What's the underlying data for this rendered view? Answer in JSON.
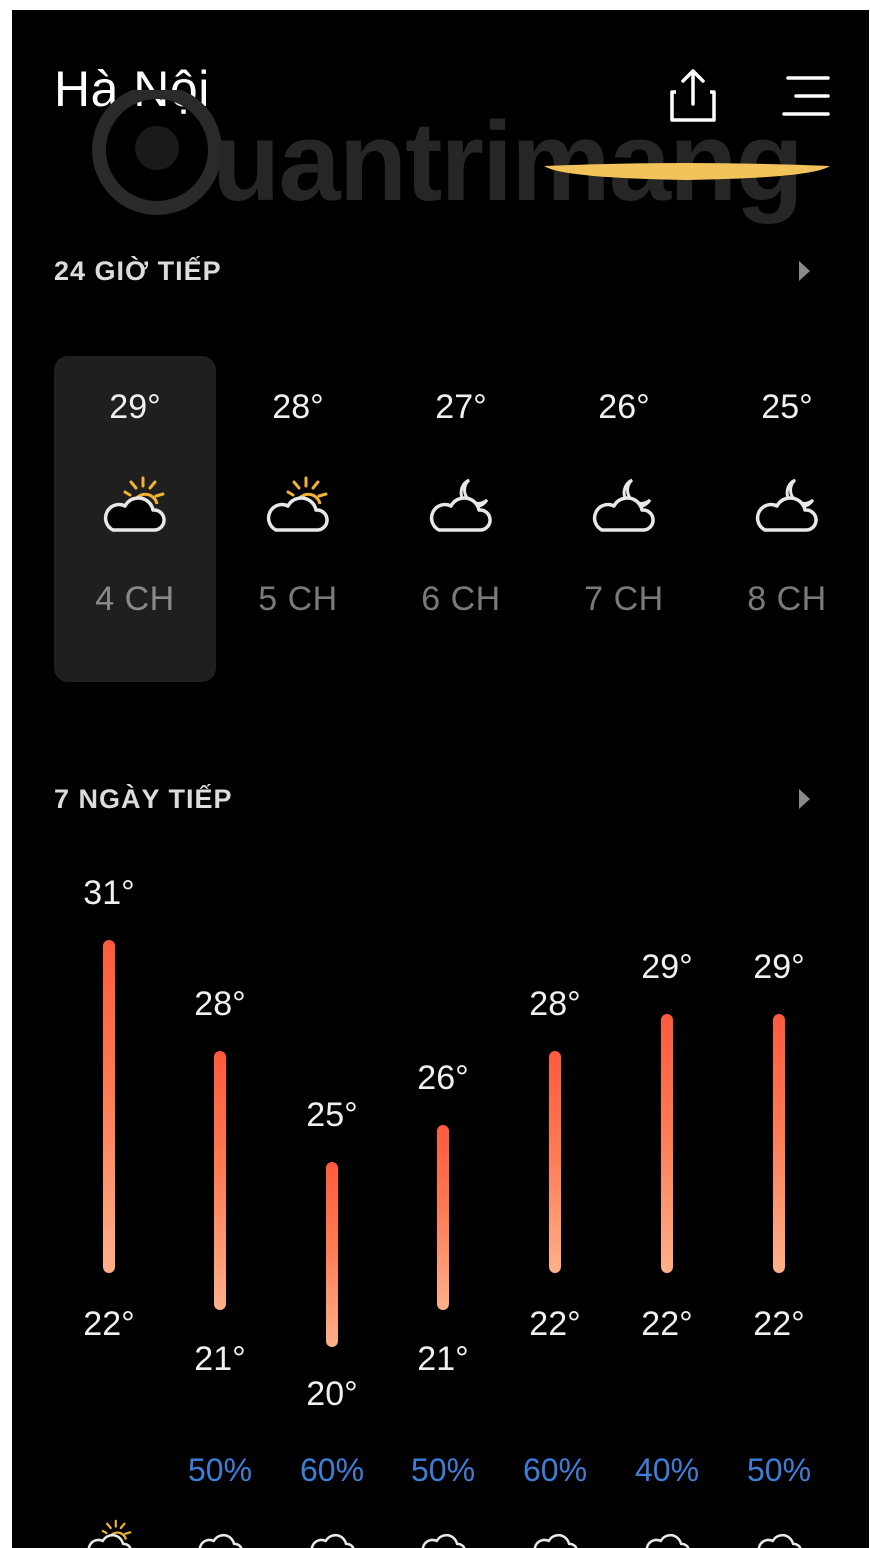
{
  "header": {
    "city": "Hà Nội",
    "watermark_text": "Quantrimang",
    "share_icon": "share-icon",
    "menu_icon": "menu-icon"
  },
  "hourly": {
    "section_title": "24 GIỜ TIẾP",
    "arrow_icon": "chevron-right-icon",
    "items": [
      {
        "temp": "29°",
        "label": "4 CH",
        "icon": "partly-sunny-icon",
        "selected": true
      },
      {
        "temp": "28°",
        "label": "5 CH",
        "icon": "partly-sunny-icon",
        "selected": false
      },
      {
        "temp": "27°",
        "label": "6 CH",
        "icon": "partly-cloudy-night-icon",
        "selected": false
      },
      {
        "temp": "26°",
        "label": "7 CH",
        "icon": "partly-cloudy-night-icon",
        "selected": false
      },
      {
        "temp": "25°",
        "label": "8 CH",
        "icon": "partly-cloudy-night-icon",
        "selected": false
      }
    ]
  },
  "daily": {
    "section_title": "7 NGÀY TIẾP",
    "arrow_icon": "chevron-right-icon",
    "items": [
      {
        "high": "31°",
        "low": "22°",
        "high_value": 31,
        "low_value": 22,
        "rain": "",
        "icon": "partly-sunny-icon"
      },
      {
        "high": "28°",
        "low": "21°",
        "high_value": 28,
        "low_value": 21,
        "rain": "50%",
        "icon": "rain-cloud-icon"
      },
      {
        "high": "25°",
        "low": "20°",
        "high_value": 25,
        "low_value": 20,
        "rain": "60%",
        "icon": "rain-cloud-icon"
      },
      {
        "high": "26°",
        "low": "21°",
        "high_value": 26,
        "low_value": 21,
        "rain": "50%",
        "icon": "rain-cloud-icon"
      },
      {
        "high": "28°",
        "low": "22°",
        "high_value": 28,
        "low_value": 22,
        "rain": "60%",
        "icon": "rain-cloud-icon"
      },
      {
        "high": "29°",
        "low": "22°",
        "high_value": 29,
        "low_value": 22,
        "rain": "40%",
        "icon": "rain-cloud-icon"
      },
      {
        "high": "29°",
        "low": "22°",
        "high_value": 29,
        "low_value": 22,
        "rain": "50%",
        "icon": "rain-cloud-icon"
      }
    ]
  },
  "colors": {
    "background": "#000000",
    "selected_card": "#1f1f1f",
    "bar_top": "#ff5a3c",
    "bar_bottom": "#ffb08a",
    "rain_text": "#3d7fd8",
    "accent_yellow": "#f2c35a"
  }
}
